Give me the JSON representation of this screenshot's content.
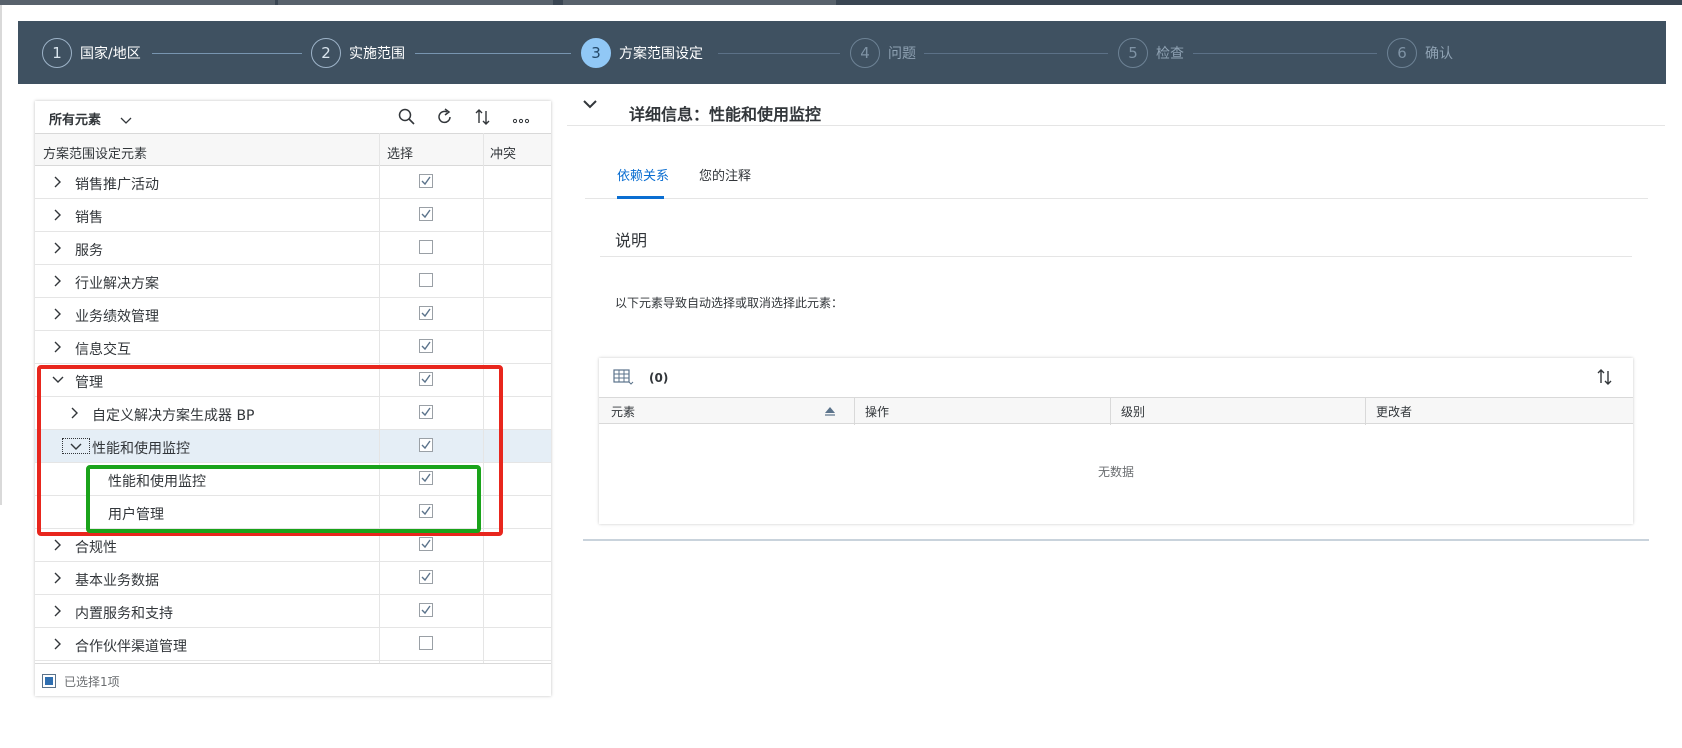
{
  "wizard": {
    "steps": [
      {
        "num": "1",
        "label": "国家/地区"
      },
      {
        "num": "2",
        "label": "实施范围"
      },
      {
        "num": "3",
        "label": "方案范围设定"
      },
      {
        "num": "4",
        "label": "问题"
      },
      {
        "num": "5",
        "label": "检查"
      },
      {
        "num": "6",
        "label": "确认"
      }
    ],
    "active_step": 3
  },
  "left_panel": {
    "filter_label": "所有元素",
    "toolbar_icons": [
      "search-icon",
      "refresh-icon",
      "sort-icon",
      "overflow-icon"
    ],
    "columns": [
      "方案范围设定元素",
      "选择",
      "冲突"
    ],
    "rows": [
      {
        "label": "销售推广活动",
        "expanded": false,
        "level": 0,
        "checked": true
      },
      {
        "label": "销售",
        "expanded": false,
        "level": 0,
        "checked": true
      },
      {
        "label": "服务",
        "expanded": false,
        "level": 0,
        "checked": false
      },
      {
        "label": "行业解决方案",
        "expanded": false,
        "level": 0,
        "checked": false
      },
      {
        "label": "业务绩效管理",
        "expanded": false,
        "level": 0,
        "checked": true
      },
      {
        "label": "信息交互",
        "expanded": false,
        "level": 0,
        "checked": true
      },
      {
        "label": "管理",
        "expanded": true,
        "level": 0,
        "checked": true
      },
      {
        "label": "自定义解决方案生成器 BP",
        "expanded": false,
        "level": 1,
        "checked": true
      },
      {
        "label": "性能和使用监控",
        "expanded": true,
        "level": 1,
        "checked": true,
        "selected": true
      },
      {
        "label": "性能和使用监控",
        "level": 2,
        "checked": true
      },
      {
        "label": "用户管理",
        "level": 2,
        "checked": true
      },
      {
        "label": "合规性",
        "expanded": false,
        "level": 0,
        "checked": true
      },
      {
        "label": "基本业务数据",
        "expanded": false,
        "level": 0,
        "checked": true
      },
      {
        "label": "内置服务和支持",
        "expanded": false,
        "level": 0,
        "checked": true
      },
      {
        "label": "合作伙伴渠道管理",
        "expanded": false,
        "level": 0,
        "checked": false
      }
    ],
    "footer": "已选择1项"
  },
  "detail": {
    "title": "详细信息：性能和使用监控",
    "tabs": [
      "依赖关系",
      "您的注释"
    ],
    "active_tab": "依赖关系",
    "section_title": "说明",
    "description": "以下元素导致自动选择或取消选择此元素：",
    "table": {
      "count": "(0)",
      "columns": [
        "元素",
        "操作",
        "级别",
        "更改者"
      ],
      "no_data": "无数据"
    }
  },
  "colors": {
    "wizard_bg": "#3f5161",
    "accent": "#0a6ed1",
    "highlight_red": "#e8261d",
    "highlight_green": "#1aa31a"
  }
}
